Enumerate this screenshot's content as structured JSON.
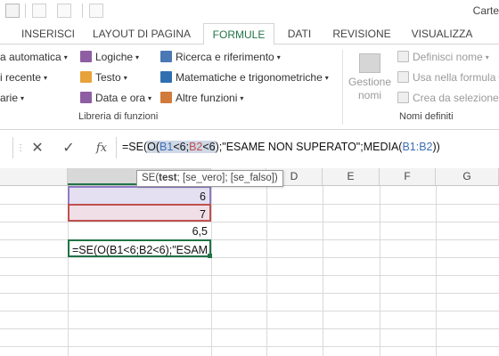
{
  "app": {
    "title": "Carte"
  },
  "tabs": [
    "INSERISCI",
    "LAYOUT DI PAGINA",
    "FORMULE",
    "DATI",
    "REVISIONE",
    "VISUALIZZA"
  ],
  "active_tab": "FORMULE",
  "ribbon": {
    "library": {
      "autosum": "a automatica",
      "recent": "i recente",
      "financial": "arie",
      "logical": "Logiche",
      "text": "Testo",
      "datetime": "Data e ora",
      "lookup": "Ricerca e riferimento",
      "math": "Matematiche e trigonometriche",
      "more": "Altre funzioni",
      "label": "Libreria di funzioni"
    },
    "names": {
      "manager_line1": "Gestione",
      "manager_line2": "nomi",
      "define": "Definisci nome",
      "use": "Usa nella formula",
      "create": "Crea da selezione",
      "label": "Nomi definiti"
    }
  },
  "formula_bar": {
    "cancel": "✕",
    "enter": "✓",
    "fx": "fx",
    "parts": [
      "=SE(",
      "O(",
      "B1",
      "<6;",
      "B2",
      "<6",
      ");\"ESAME NON SUPERATO\";MEDIA(",
      "B1:B2",
      "))"
    ]
  },
  "tooltip": {
    "fname": "SE(",
    "arg1": "test",
    "rest": "; [se_vero]; [se_falso])"
  },
  "columns": [
    "D",
    "E",
    "F",
    "G"
  ],
  "cells": {
    "b1": "6",
    "b2": "7",
    "b3": "6,5",
    "b4": "=SE(O(B1<6;B2<6);\"ESAM"
  },
  "colors": {
    "accent": "#217346",
    "ref_blue": "#3f6fb6",
    "ref_red": "#c0504d"
  }
}
